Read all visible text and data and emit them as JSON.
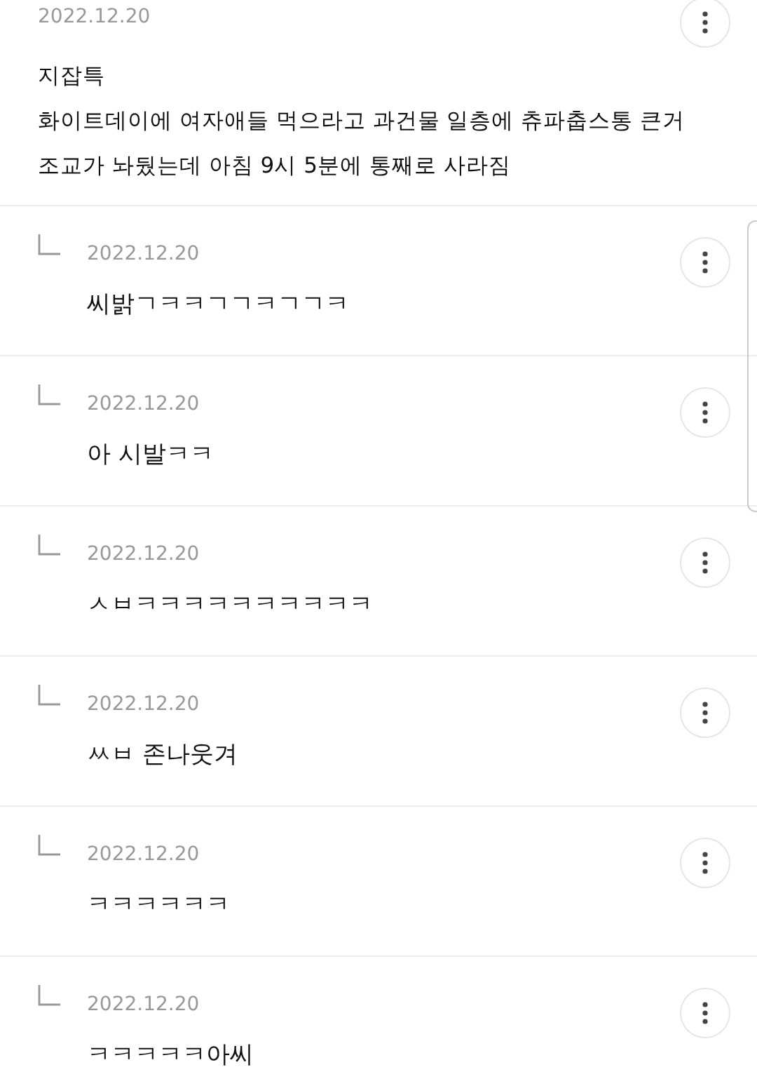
{
  "comment": {
    "date": "2022.12.20",
    "lines": [
      "지잡특",
      "화이트데이에 여자애들 먹으라고 과건물 일층에 츄파춥스통 큰거",
      "조교가 놔뒀는데 아침 9시 5분에 통째로 사라짐"
    ]
  },
  "replies": [
    {
      "date": "2022.12.20",
      "text": "씨밝ㄱㅋㅋㄱㄱㅋㄱㄱㅋ"
    },
    {
      "date": "2022.12.20",
      "text": "아 시발ㅋㅋ"
    },
    {
      "date": "2022.12.20",
      "text": "ㅅㅂㅋㅋㅋㅋㅋㅋㅋㅋㅋㅋ"
    },
    {
      "date": "2022.12.20",
      "text": "ㅆㅂ 존나웃겨"
    },
    {
      "date": "2022.12.20",
      "text": "ㅋㅋㅋㅋㅋㅋ"
    },
    {
      "date": "2022.12.20",
      "text": "ㅋㅋㅋㅋㅋ아씨"
    }
  ]
}
